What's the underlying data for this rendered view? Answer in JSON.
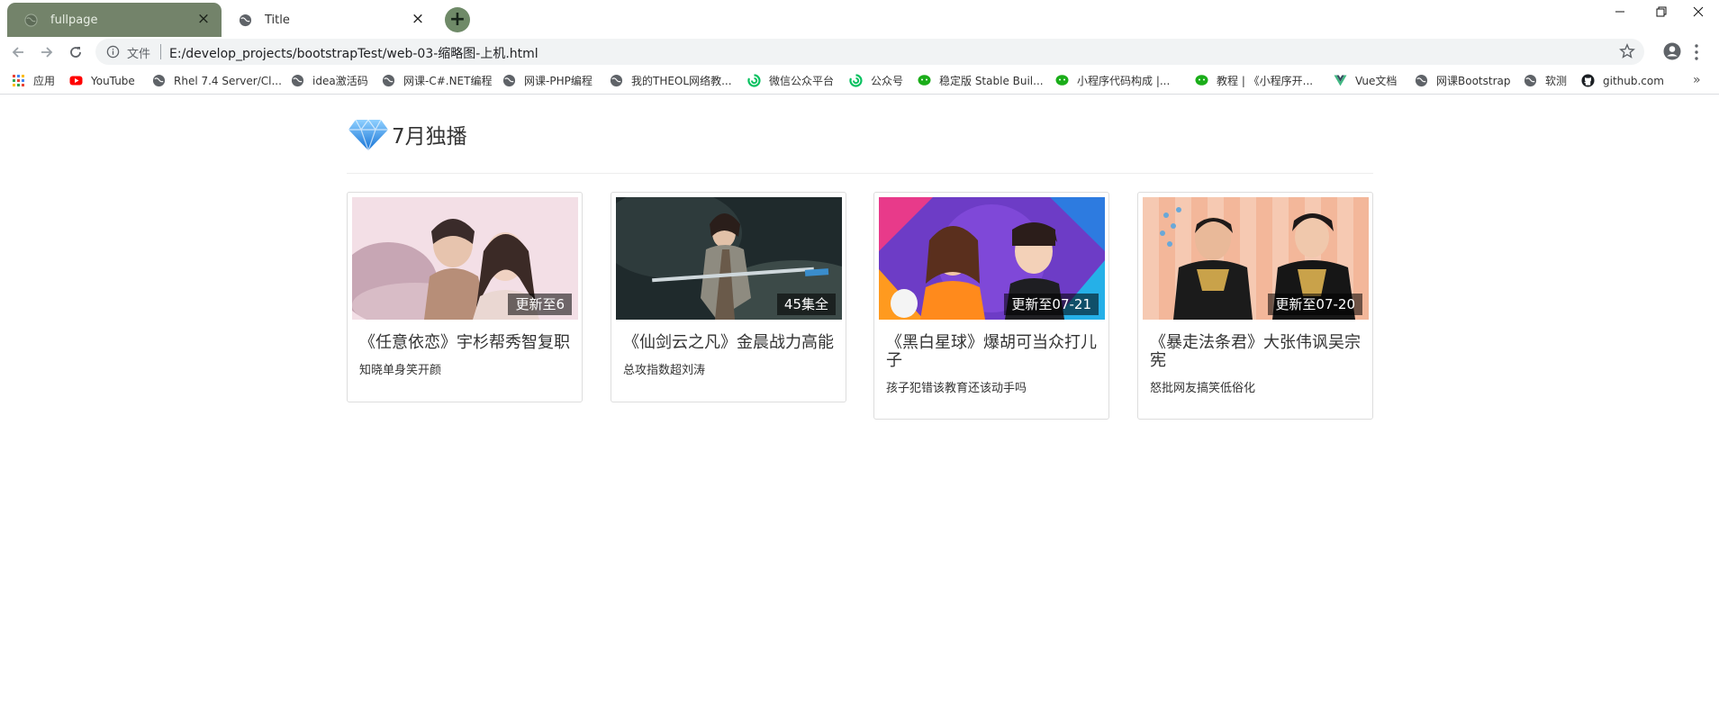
{
  "browser": {
    "tabs": [
      {
        "title": "fullpage",
        "active": false
      },
      {
        "title": "Title",
        "active": true
      }
    ],
    "address": {
      "file_label": "文件",
      "url": "E:/develop_projects/bootstrapTest/web-03-缩略图-上机.html"
    },
    "bookmarks": [
      {
        "label": "应用",
        "icon": "apps-grid-icon"
      },
      {
        "label": "YouTube",
        "icon": "youtube-icon"
      },
      {
        "label": "Rhel 7.4 Server/Cl...",
        "icon": "globe-icon"
      },
      {
        "label": "idea激活码",
        "icon": "globe-icon"
      },
      {
        "label": "网课-C#.NET编程",
        "icon": "globe-icon"
      },
      {
        "label": "网课-PHP编程",
        "icon": "globe-icon"
      },
      {
        "label": "我的THEOL网络教...",
        "icon": "globe-icon"
      },
      {
        "label": "微信公众平台",
        "icon": "wechat-mp-icon"
      },
      {
        "label": "公众号",
        "icon": "wechat-mp-icon"
      },
      {
        "label": "稳定版 Stable Buil...",
        "icon": "wechat-icon"
      },
      {
        "label": "小程序代码构成 |...",
        "icon": "wechat-icon"
      },
      {
        "label": "教程 | 《小程序开...",
        "icon": "wechat-icon"
      },
      {
        "label": "Vue文档",
        "icon": "vue-icon"
      },
      {
        "label": "网课Bootstrap",
        "icon": "globe-icon"
      },
      {
        "label": "软测",
        "icon": "globe-icon"
      },
      {
        "label": "github.com",
        "icon": "github-icon"
      }
    ],
    "more_label": "»"
  },
  "page": {
    "heading": "7月独播",
    "heading_icon": "diamond-icon",
    "cards": [
      {
        "badge": "更新至6",
        "title": "《任意依恋》宇杉帮秀智复职",
        "desc": "知晓单身笑开颜"
      },
      {
        "badge": "45集全",
        "title": "《仙剑云之凡》金晨战力高能",
        "desc": "总攻指数超刘涛"
      },
      {
        "badge": "更新至07-21",
        "title": "《黑白星球》爆胡可当众打儿子",
        "desc": "孩子犯错该教育还该动手吗"
      },
      {
        "badge": "更新至07-20",
        "title": "《暴走法条君》大张伟讽吴宗宪",
        "desc": "怒批网友搞笑低俗化"
      }
    ]
  },
  "colors": {
    "tab_inactive": "#73836a",
    "new_tab": "#6f8a68",
    "omnibox": "#f1f3f4",
    "diamond": "#3aa0f0"
  }
}
